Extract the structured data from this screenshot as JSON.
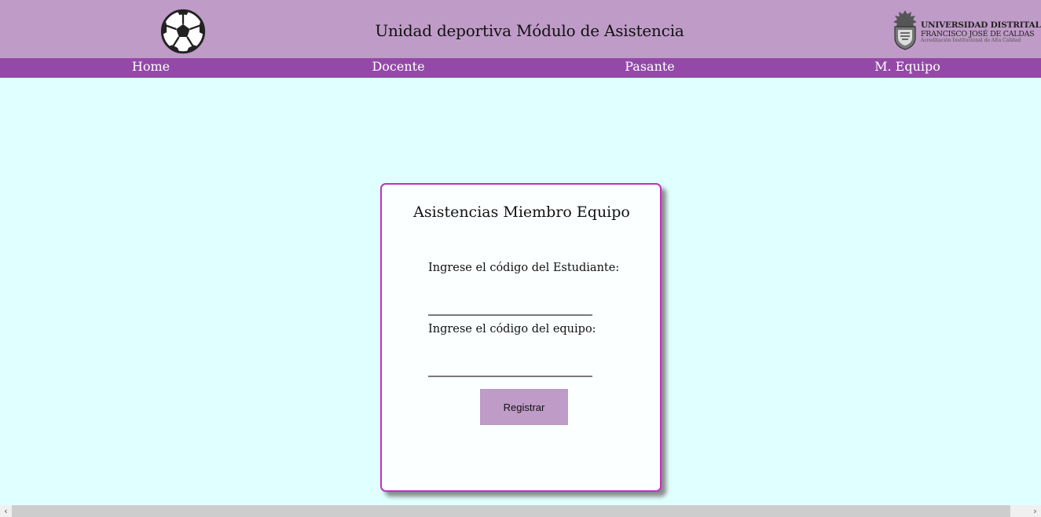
{
  "header": {
    "title": "Unidad deportiva Módulo de Asistencia",
    "ball_icon": "soccer-ball-icon",
    "logo": {
      "line1": "UNIVERSIDAD DISTRITAL",
      "line2": "FRANCISCO JOSÉ DE CALDAS",
      "line3": "Acreditación Institucional de Alta Calidad"
    },
    "background": "#bf9bc7"
  },
  "nav": {
    "background": "#9449a8",
    "items": [
      {
        "label": "Home"
      },
      {
        "label": "Docente"
      },
      {
        "label": "Pasante"
      },
      {
        "label": "M. Equipo"
      }
    ]
  },
  "form": {
    "title": "Asistencias Miembro Equipo",
    "student_code_label": "Ingrese el código del Estudiante:",
    "student_code_value": "",
    "team_code_label": "Ingrese el código del equipo:",
    "team_code_value": "",
    "submit_label": "Registrar",
    "border_color": "#c032bc",
    "button_color": "#bf9bc7"
  },
  "page": {
    "background": "#e0ffff"
  },
  "scrollbar": {
    "left_icon": "chevron-left-icon",
    "right_icon": "chevron-right-icon"
  }
}
